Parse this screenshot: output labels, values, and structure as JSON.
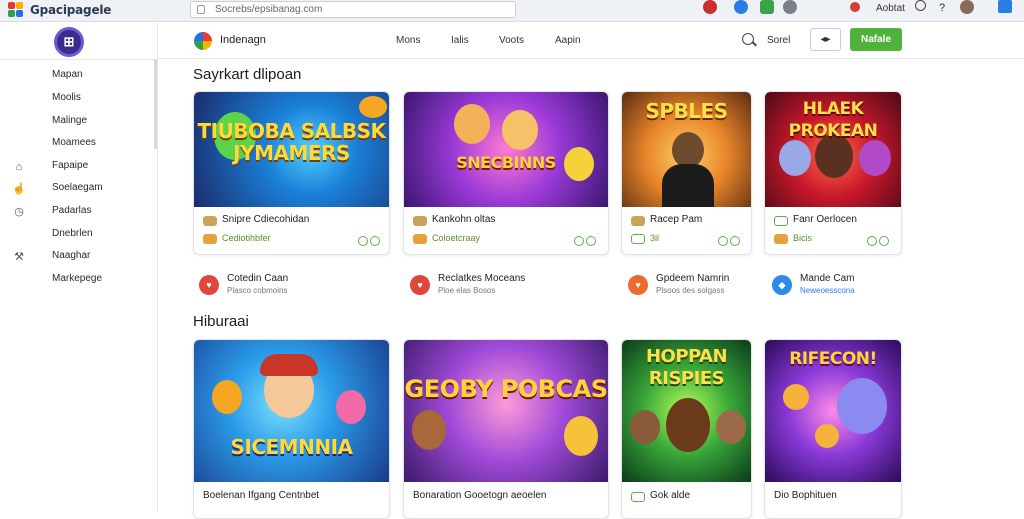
{
  "top_bar": {
    "brand": "Gpacipagele",
    "url": "Socrebs/epsibanag.com",
    "account_label": "Aobtat",
    "icons": [
      "record-icon",
      "shield-icon",
      "extension-icon",
      "notification-icon",
      "profile-dot-icon",
      "search-icon",
      "help-icon",
      "avatar",
      "window-icon"
    ]
  },
  "sidebar": {
    "logo_text": "⊞",
    "items": [
      {
        "label": "Mapan",
        "icon": ""
      },
      {
        "label": "Moolis",
        "icon": ""
      },
      {
        "label": "Malinge",
        "icon": ""
      },
      {
        "label": "Moamees",
        "icon": ""
      },
      {
        "label": "Fapaipe",
        "icon": "store-icon"
      },
      {
        "label": "Soelaegam",
        "icon": "hand-icon"
      },
      {
        "label": "Padarlas",
        "icon": "clock-icon"
      },
      {
        "label": "Dnebrlen",
        "icon": ""
      },
      {
        "label": "Naaghar",
        "icon": "tools-icon"
      },
      {
        "label": "Markepege",
        "icon": ""
      }
    ]
  },
  "header": {
    "title": "Indenagn",
    "nav": [
      "Mons",
      "Ialis",
      "Voots",
      "Aapin"
    ],
    "search_label": "Sorel",
    "outline_button": "◂▸",
    "primary_button": "Nafale"
  },
  "sections": [
    {
      "title": "Sayrkart dlipoan",
      "cards": [
        {
          "art_text": "TIUBOBA SALBSK JYMAMERS",
          "title": "Snipre Cdiecohidan",
          "subtitle": "Cediotihbfer"
        },
        {
          "art_text": "SNECBINNS",
          "title": "Kankohn oltas",
          "subtitle": "Coloetcraay"
        },
        {
          "art_text": "SPBLES",
          "title": "Racep Pam",
          "subtitle": "3il"
        },
        {
          "art_text": "HLAEK PROKEAN",
          "title": "Fanr Oerlocen",
          "subtitle": "Bicis"
        }
      ],
      "developers": [
        {
          "name": "Cotedin Caan",
          "sub": "Plasco cobmoins"
        },
        {
          "name": "Reclatkes Moceans",
          "sub": "Ploe elas Bosos"
        },
        {
          "name": "Gpdeem Namrin",
          "sub": "Plsoos des solgass"
        },
        {
          "name": "Mande Cam",
          "sub": "Neweoesscona"
        }
      ]
    },
    {
      "title": "Hiburaai",
      "cards": [
        {
          "art_text": "SICEMNNIA",
          "title": "Boelenan Ifgang Centnbet",
          "subtitle": ""
        },
        {
          "art_text": "GEOBY POBCAS",
          "title": "Bonaration Gooetogn aeoelen",
          "subtitle": ""
        },
        {
          "art_text": "HOPPAN RISPIES",
          "title": "Gok alde",
          "subtitle": ""
        },
        {
          "art_text": "RIFECON!",
          "title": "Dio Bophituen",
          "subtitle": ""
        }
      ]
    }
  ],
  "colors": {
    "accent_green": "#4fb23b",
    "link_blue": "#2b7de6",
    "dev_red": "#e1463a",
    "dev_orange": "#ec6a2c",
    "dev_blue": "#2b8be6"
  }
}
